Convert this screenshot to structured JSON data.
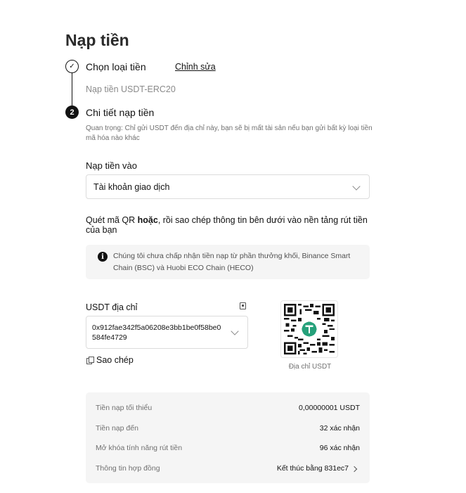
{
  "page": {
    "title": "Nạp tiền"
  },
  "step1": {
    "number": "✓",
    "label": "Chọn loại tiền",
    "edit_label": "Chỉnh sửa",
    "value": "Nạp tiền USDT-ERC20"
  },
  "step2": {
    "number": "2",
    "label": "Chi tiết nạp tiền",
    "warning": "Quan trọng: Chỉ gửi USDT đến địa chỉ này, bạn sẽ bị mất tài sản nếu bạn gửi bất kỳ loại tiền mã hóa nào khác"
  },
  "deposit_to": {
    "label": "Nạp tiền vào",
    "selected": "Tài khoản giao dịch"
  },
  "scan": {
    "prefix": "Quét mã QR ",
    "bold": "hoặc",
    "suffix": ", rồi sao chép thông tin bên dưới vào nền tảng rút tiền của bạn"
  },
  "notice": {
    "icon": "info-icon",
    "text": "Chúng tôi chưa chấp nhận tiền nạp từ phần thưởng khối, Binance Smart Chain (BSC) và Huobi ECO Chain (HECO)"
  },
  "address": {
    "label": "USDT địa chỉ",
    "value": "0x912fae342f5a06208e3bb1be0f58be0584fe4729",
    "copy_label": "Sao chép",
    "qr_caption": "Địa chỉ USDT"
  },
  "info": [
    {
      "key": "Tiền nạp tối thiểu",
      "value": "0,00000001 USDT"
    },
    {
      "key": "Tiền nạp đến",
      "value": "32 xác nhận"
    },
    {
      "key": "Mở khóa tính năng rút tiền",
      "value": "96 xác nhận"
    },
    {
      "key": "Thông tin hợp đồng",
      "value": "Kết thúc bằng 831ec7"
    }
  ],
  "colors": {
    "text": "#121212",
    "muted": "#707070",
    "panel": "#f5f5f5",
    "tether": "#26a17b"
  }
}
